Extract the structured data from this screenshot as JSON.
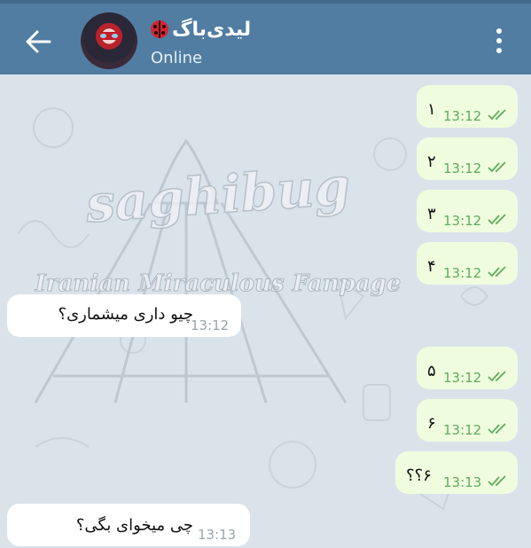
{
  "header": {
    "contact_name": "لیدی‌باگ",
    "status": "Online",
    "colors": {
      "bar": "#517da2",
      "text": "#ffffff"
    }
  },
  "chat": {
    "watermark": {
      "title": "saghibug",
      "subtitle": "Iranian Miraculous Fanpage"
    },
    "messages": [
      {
        "dir": "out",
        "text": "۱",
        "time": "13:12"
      },
      {
        "dir": "out",
        "text": "۲",
        "time": "13:12"
      },
      {
        "dir": "out",
        "text": "۳",
        "time": "13:12"
      },
      {
        "dir": "out",
        "text": "۴",
        "time": "13:12"
      },
      {
        "dir": "in",
        "text": "چیو داری میشماری؟",
        "time": "13:12"
      },
      {
        "dir": "out",
        "text": "۵",
        "time": "13:12"
      },
      {
        "dir": "out",
        "text": "۶",
        "time": "13:12"
      },
      {
        "dir": "out",
        "text": "۶؟؟",
        "time": "13:13"
      },
      {
        "dir": "in",
        "text": "چی میخوای بگی؟",
        "time": "13:13"
      }
    ],
    "colors": {
      "outgoing": "#effdde",
      "incoming": "#ffffff",
      "background": "#dbe3ea"
    }
  }
}
